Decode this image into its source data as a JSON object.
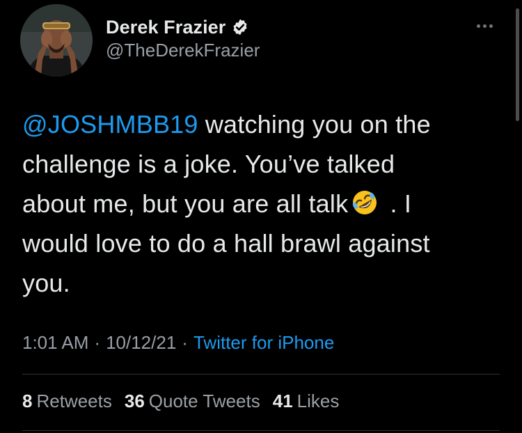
{
  "author": {
    "display_name": "Derek Frazier",
    "handle": "@TheDerekFrazier",
    "verified": true
  },
  "tweet": {
    "mention": "@JOSHMBB19",
    "text_line1_rest": " watching you on the",
    "text_line2": "challenge is a joke. You’ve talked",
    "text_line3_before_emoji": "about me, but you are all talk",
    "emoji": "rolling-on-floor-laughing",
    "text_line3_after_emoji": " . I",
    "text_line4": "would love to do a hall brawl against",
    "text_line5": "you."
  },
  "meta": {
    "time": "1:01 AM",
    "separator": "·",
    "date": "10/12/21",
    "source": "Twitter for iPhone"
  },
  "stats": {
    "retweets_count": "8",
    "retweets_label": "Retweets",
    "quotes_count": "36",
    "quotes_label": "Quote Tweets",
    "likes_count": "41",
    "likes_label": "Likes"
  },
  "colors": {
    "background": "#000000",
    "text": "#e7e9ea",
    "secondary": "#9aa0a6",
    "accent": "#1d9bf0",
    "divider": "#2f3336"
  }
}
